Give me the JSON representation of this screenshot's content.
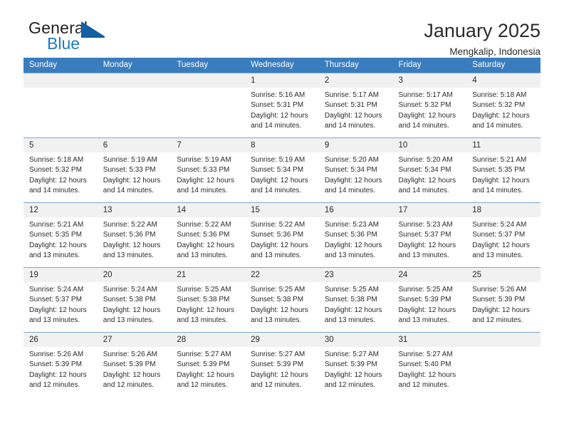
{
  "brand": {
    "name_top": "General",
    "name_bottom": "Blue",
    "accent_color": "#135fa4",
    "blue_text_color": "#1f7ac4"
  },
  "header": {
    "title": "January 2025",
    "subtitle": "Mengkalip, Indonesia",
    "header_bg": "#3a7dbf",
    "daynum_bg": "#f1f1f1"
  },
  "calendar": {
    "weekday_headers": [
      "Sunday",
      "Monday",
      "Tuesday",
      "Wednesday",
      "Thursday",
      "Friday",
      "Saturday"
    ],
    "weeks": [
      [
        {
          "day": "",
          "sunrise": "",
          "sunset": "",
          "daylight_line1": "",
          "daylight_line2": ""
        },
        {
          "day": "",
          "sunrise": "",
          "sunset": "",
          "daylight_line1": "",
          "daylight_line2": ""
        },
        {
          "day": "",
          "sunrise": "",
          "sunset": "",
          "daylight_line1": "",
          "daylight_line2": ""
        },
        {
          "day": "1",
          "sunrise": "Sunrise: 5:16 AM",
          "sunset": "Sunset: 5:31 PM",
          "daylight_line1": "Daylight: 12 hours",
          "daylight_line2": "and 14 minutes."
        },
        {
          "day": "2",
          "sunrise": "Sunrise: 5:17 AM",
          "sunset": "Sunset: 5:31 PM",
          "daylight_line1": "Daylight: 12 hours",
          "daylight_line2": "and 14 minutes."
        },
        {
          "day": "3",
          "sunrise": "Sunrise: 5:17 AM",
          "sunset": "Sunset: 5:32 PM",
          "daylight_line1": "Daylight: 12 hours",
          "daylight_line2": "and 14 minutes."
        },
        {
          "day": "4",
          "sunrise": "Sunrise: 5:18 AM",
          "sunset": "Sunset: 5:32 PM",
          "daylight_line1": "Daylight: 12 hours",
          "daylight_line2": "and 14 minutes."
        }
      ],
      [
        {
          "day": "5",
          "sunrise": "Sunrise: 5:18 AM",
          "sunset": "Sunset: 5:32 PM",
          "daylight_line1": "Daylight: 12 hours",
          "daylight_line2": "and 14 minutes."
        },
        {
          "day": "6",
          "sunrise": "Sunrise: 5:19 AM",
          "sunset": "Sunset: 5:33 PM",
          "daylight_line1": "Daylight: 12 hours",
          "daylight_line2": "and 14 minutes."
        },
        {
          "day": "7",
          "sunrise": "Sunrise: 5:19 AM",
          "sunset": "Sunset: 5:33 PM",
          "daylight_line1": "Daylight: 12 hours",
          "daylight_line2": "and 14 minutes."
        },
        {
          "day": "8",
          "sunrise": "Sunrise: 5:19 AM",
          "sunset": "Sunset: 5:34 PM",
          "daylight_line1": "Daylight: 12 hours",
          "daylight_line2": "and 14 minutes."
        },
        {
          "day": "9",
          "sunrise": "Sunrise: 5:20 AM",
          "sunset": "Sunset: 5:34 PM",
          "daylight_line1": "Daylight: 12 hours",
          "daylight_line2": "and 14 minutes."
        },
        {
          "day": "10",
          "sunrise": "Sunrise: 5:20 AM",
          "sunset": "Sunset: 5:34 PM",
          "daylight_line1": "Daylight: 12 hours",
          "daylight_line2": "and 14 minutes."
        },
        {
          "day": "11",
          "sunrise": "Sunrise: 5:21 AM",
          "sunset": "Sunset: 5:35 PM",
          "daylight_line1": "Daylight: 12 hours",
          "daylight_line2": "and 14 minutes."
        }
      ],
      [
        {
          "day": "12",
          "sunrise": "Sunrise: 5:21 AM",
          "sunset": "Sunset: 5:35 PM",
          "daylight_line1": "Daylight: 12 hours",
          "daylight_line2": "and 13 minutes."
        },
        {
          "day": "13",
          "sunrise": "Sunrise: 5:22 AM",
          "sunset": "Sunset: 5:36 PM",
          "daylight_line1": "Daylight: 12 hours",
          "daylight_line2": "and 13 minutes."
        },
        {
          "day": "14",
          "sunrise": "Sunrise: 5:22 AM",
          "sunset": "Sunset: 5:36 PM",
          "daylight_line1": "Daylight: 12 hours",
          "daylight_line2": "and 13 minutes."
        },
        {
          "day": "15",
          "sunrise": "Sunrise: 5:22 AM",
          "sunset": "Sunset: 5:36 PM",
          "daylight_line1": "Daylight: 12 hours",
          "daylight_line2": "and 13 minutes."
        },
        {
          "day": "16",
          "sunrise": "Sunrise: 5:23 AM",
          "sunset": "Sunset: 5:36 PM",
          "daylight_line1": "Daylight: 12 hours",
          "daylight_line2": "and 13 minutes."
        },
        {
          "day": "17",
          "sunrise": "Sunrise: 5:23 AM",
          "sunset": "Sunset: 5:37 PM",
          "daylight_line1": "Daylight: 12 hours",
          "daylight_line2": "and 13 minutes."
        },
        {
          "day": "18",
          "sunrise": "Sunrise: 5:24 AM",
          "sunset": "Sunset: 5:37 PM",
          "daylight_line1": "Daylight: 12 hours",
          "daylight_line2": "and 13 minutes."
        }
      ],
      [
        {
          "day": "19",
          "sunrise": "Sunrise: 5:24 AM",
          "sunset": "Sunset: 5:37 PM",
          "daylight_line1": "Daylight: 12 hours",
          "daylight_line2": "and 13 minutes."
        },
        {
          "day": "20",
          "sunrise": "Sunrise: 5:24 AM",
          "sunset": "Sunset: 5:38 PM",
          "daylight_line1": "Daylight: 12 hours",
          "daylight_line2": "and 13 minutes."
        },
        {
          "day": "21",
          "sunrise": "Sunrise: 5:25 AM",
          "sunset": "Sunset: 5:38 PM",
          "daylight_line1": "Daylight: 12 hours",
          "daylight_line2": "and 13 minutes."
        },
        {
          "day": "22",
          "sunrise": "Sunrise: 5:25 AM",
          "sunset": "Sunset: 5:38 PM",
          "daylight_line1": "Daylight: 12 hours",
          "daylight_line2": "and 13 minutes."
        },
        {
          "day": "23",
          "sunrise": "Sunrise: 5:25 AM",
          "sunset": "Sunset: 5:38 PM",
          "daylight_line1": "Daylight: 12 hours",
          "daylight_line2": "and 13 minutes."
        },
        {
          "day": "24",
          "sunrise": "Sunrise: 5:25 AM",
          "sunset": "Sunset: 5:39 PM",
          "daylight_line1": "Daylight: 12 hours",
          "daylight_line2": "and 13 minutes."
        },
        {
          "day": "25",
          "sunrise": "Sunrise: 5:26 AM",
          "sunset": "Sunset: 5:39 PM",
          "daylight_line1": "Daylight: 12 hours",
          "daylight_line2": "and 12 minutes."
        }
      ],
      [
        {
          "day": "26",
          "sunrise": "Sunrise: 5:26 AM",
          "sunset": "Sunset: 5:39 PM",
          "daylight_line1": "Daylight: 12 hours",
          "daylight_line2": "and 12 minutes."
        },
        {
          "day": "27",
          "sunrise": "Sunrise: 5:26 AM",
          "sunset": "Sunset: 5:39 PM",
          "daylight_line1": "Daylight: 12 hours",
          "daylight_line2": "and 12 minutes."
        },
        {
          "day": "28",
          "sunrise": "Sunrise: 5:27 AM",
          "sunset": "Sunset: 5:39 PM",
          "daylight_line1": "Daylight: 12 hours",
          "daylight_line2": "and 12 minutes."
        },
        {
          "day": "29",
          "sunrise": "Sunrise: 5:27 AM",
          "sunset": "Sunset: 5:39 PM",
          "daylight_line1": "Daylight: 12 hours",
          "daylight_line2": "and 12 minutes."
        },
        {
          "day": "30",
          "sunrise": "Sunrise: 5:27 AM",
          "sunset": "Sunset: 5:39 PM",
          "daylight_line1": "Daylight: 12 hours",
          "daylight_line2": "and 12 minutes."
        },
        {
          "day": "31",
          "sunrise": "Sunrise: 5:27 AM",
          "sunset": "Sunset: 5:40 PM",
          "daylight_line1": "Daylight: 12 hours",
          "daylight_line2": "and 12 minutes."
        },
        {
          "day": "",
          "sunrise": "",
          "sunset": "",
          "daylight_line1": "",
          "daylight_line2": ""
        }
      ]
    ]
  }
}
